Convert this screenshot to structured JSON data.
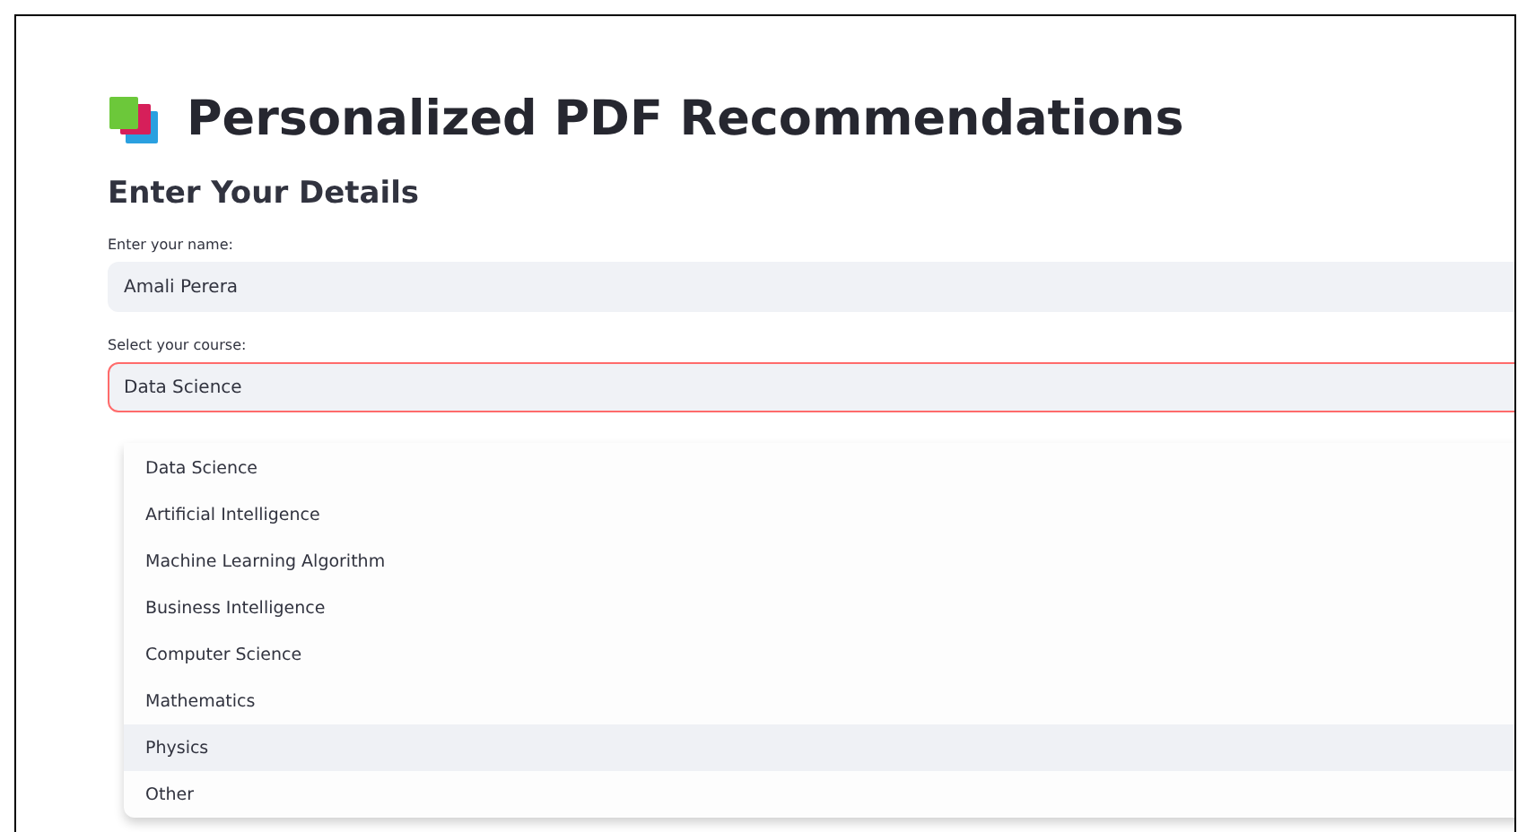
{
  "title": "Personalized PDF Recommendations",
  "section": "Enter Your Details",
  "name_field": {
    "label": "Enter your name:",
    "value": "Amali Perera"
  },
  "course_select": {
    "label": "Select your course:",
    "value": "Data Science",
    "focused": true,
    "options": [
      {
        "label": "Data Science",
        "highlighted": false
      },
      {
        "label": "Artificial Intelligence",
        "highlighted": false
      },
      {
        "label": "Machine Learning Algorithm",
        "highlighted": false
      },
      {
        "label": "Business Intelligence",
        "highlighted": false
      },
      {
        "label": "Computer Science",
        "highlighted": false
      },
      {
        "label": "Mathematics",
        "highlighted": false
      },
      {
        "label": "Physics",
        "highlighted": true
      },
      {
        "label": "Other",
        "highlighted": false
      }
    ]
  }
}
